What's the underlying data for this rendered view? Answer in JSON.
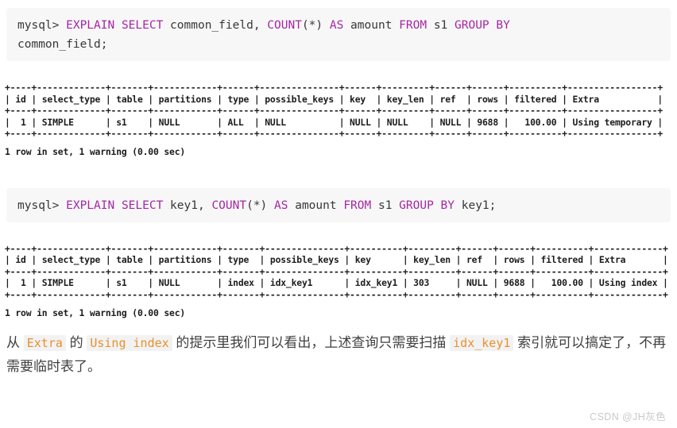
{
  "page": {
    "background": "#ffffff",
    "keyword_color": "#a626a4",
    "inline_code_color": "#e8912d",
    "code_block_bg": "#f7f7f8"
  },
  "blocks": [
    {
      "type": "code",
      "name": "sql-query-1",
      "tokens": [
        {
          "t": "mysql> ",
          "kw": false
        },
        {
          "t": "EXPLAIN SELECT",
          "kw": true
        },
        {
          "t": " common_field, ",
          "kw": false
        },
        {
          "t": "COUNT",
          "kw": true
        },
        {
          "t": "(*) ",
          "kw": false
        },
        {
          "t": "AS",
          "kw": true
        },
        {
          "t": " amount ",
          "kw": false
        },
        {
          "t": "FROM",
          "kw": true
        },
        {
          "t": " s1 ",
          "kw": false
        },
        {
          "t": "GROUP BY",
          "kw": true
        },
        {
          "t": "\ncommon_field;",
          "kw": false
        }
      ],
      "plain_text": "mysql> EXPLAIN SELECT common_field, COUNT(*) AS amount FROM s1 GROUP BY\ncommon_field;"
    },
    {
      "type": "output",
      "name": "explain-output-1",
      "columns": [
        "id",
        "select_type",
        "table",
        "partitions",
        "type",
        "possible_keys",
        "key",
        "key_len",
        "ref",
        "rows",
        "filtered",
        "Extra"
      ],
      "rows": [
        [
          "1",
          "SIMPLE",
          "s1",
          "NULL",
          "ALL",
          "NULL",
          "NULL",
          "NULL",
          "NULL",
          "9688",
          "100.00",
          "Using temporary"
        ]
      ],
      "text": "+----+-------------+-------+------------+------+---------------+------+---------+------+------+----------+-----------------+\n| id | select_type | table | partitions | type | possible_keys | key  | key_len | ref  | rows | filtered | Extra           |\n+----+-------------+-------+------------+------+---------------+------+---------+------+------+----------+-----------------+\n|  1 | SIMPLE      | s1    | NULL       | ALL  | NULL          | NULL | NULL    | NULL | 9688 |   100.00 | Using temporary |\n+----+-------------+-------+------------+------+---------------+------+---------+------+------+----------+-----------------+",
      "status": "1 row in set, 1 warning (0.00 sec)"
    },
    {
      "type": "code",
      "name": "sql-query-2",
      "tokens": [
        {
          "t": "mysql> ",
          "kw": false
        },
        {
          "t": "EXPLAIN SELECT",
          "kw": true
        },
        {
          "t": " key1, ",
          "kw": false
        },
        {
          "t": "COUNT",
          "kw": true
        },
        {
          "t": "(*) ",
          "kw": false
        },
        {
          "t": "AS",
          "kw": true
        },
        {
          "t": " amount ",
          "kw": false
        },
        {
          "t": "FROM",
          "kw": true
        },
        {
          "t": " s1 ",
          "kw": false
        },
        {
          "t": "GROUP BY",
          "kw": true
        },
        {
          "t": " key1;",
          "kw": false
        }
      ],
      "plain_text": "mysql> EXPLAIN SELECT key1, COUNT(*) AS amount FROM s1 GROUP BY key1;"
    },
    {
      "type": "output",
      "name": "explain-output-2",
      "columns": [
        "id",
        "select_type",
        "table",
        "partitions",
        "type",
        "possible_keys",
        "key",
        "key_len",
        "ref",
        "rows",
        "filtered",
        "Extra"
      ],
      "rows": [
        [
          "1",
          "SIMPLE",
          "s1",
          "NULL",
          "index",
          "idx_key1",
          "idx_key1",
          "303",
          "NULL",
          "9688",
          "100.00",
          "Using index"
        ]
      ],
      "text": "+----+-------------+-------+------------+-------+---------------+----------+---------+------+------+----------+-------------+\n| id | select_type | table | partitions | type  | possible_keys | key      | key_len | ref  | rows | filtered | Extra       |\n+----+-------------+-------+------------+-------+---------------+----------+---------+------+------+----------+-------------+\n|  1 | SIMPLE      | s1    | NULL       | index | idx_key1      | idx_key1 | 303     | NULL | 9688 |   100.00 | Using index |\n+----+-------------+-------+------------+-------+---------------+----------+---------+------+------+----------+-------------+",
      "status": "1 row in set, 1 warning (0.00 sec)"
    }
  ],
  "prose": {
    "p1": "从 ",
    "c1": "Extra",
    "p2": " 的 ",
    "c2": "Using index",
    "p3": " 的提示里我们可以看出，上述查询只需要扫描 ",
    "c3": "idx_key1",
    "p4": " 索引就可以搞定了，不再需要临时表了。"
  },
  "watermark": {
    "text": "CSDN @JH灰色"
  }
}
